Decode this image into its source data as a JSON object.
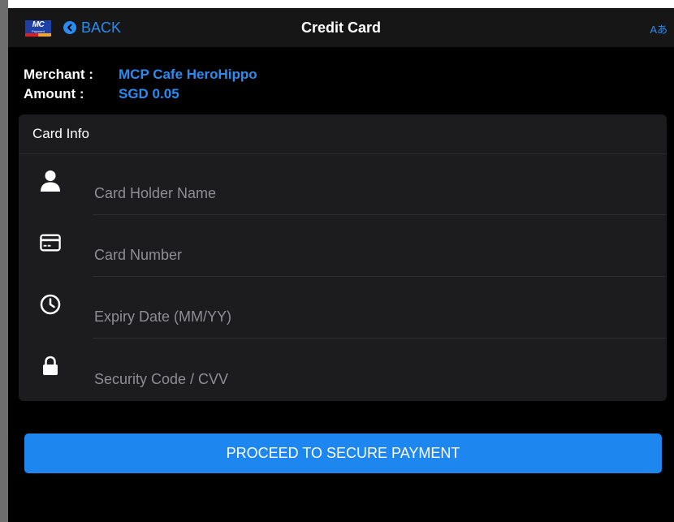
{
  "nav": {
    "logo_text": "MC",
    "logo_subtext": "Payment",
    "back_label": "BACK",
    "title": "Credit Card",
    "lang_label": "Aあ"
  },
  "merchant": {
    "merchant_key": "Merchant :",
    "merchant_value": "MCP Cafe HeroHippo",
    "amount_key": "Amount :",
    "amount_value": "SGD 0.05"
  },
  "card_info": {
    "header": "Card Info",
    "fields": [
      {
        "icon": "user-icon",
        "placeholder": "Card Holder Name",
        "value": ""
      },
      {
        "icon": "credit-card-icon",
        "placeholder": "Card Number",
        "value": ""
      },
      {
        "icon": "clock-icon",
        "placeholder": "Expiry Date (MM/YY)",
        "value": ""
      },
      {
        "icon": "lock-icon",
        "placeholder": "Security Code / CVV",
        "value": ""
      }
    ]
  },
  "proceed_button": {
    "label": "PROCEED TO SECURE PAYMENT"
  },
  "colors": {
    "accent": "#2a8cf0",
    "button": "#1e86ef",
    "panel": "#1c1c1e",
    "navbar": "#161616"
  }
}
